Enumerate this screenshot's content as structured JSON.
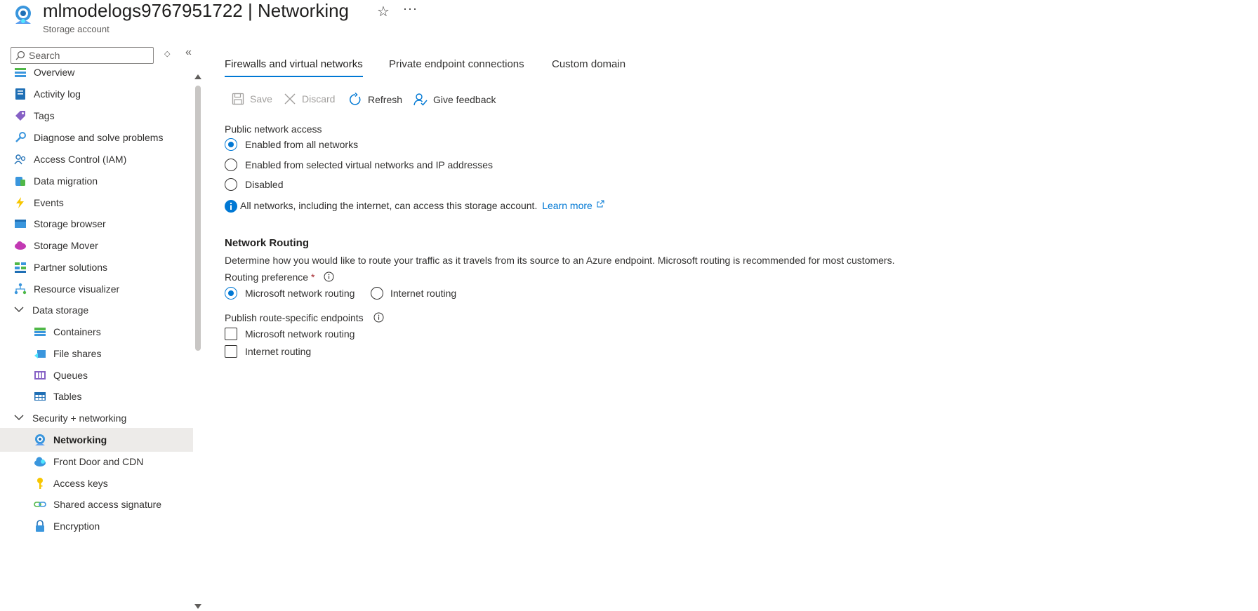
{
  "header": {
    "title": "mlmodelogs9767951722 | Networking",
    "subtitle": "Storage account",
    "more_label": "···"
  },
  "sidebar": {
    "search_placeholder": "Search",
    "items": [
      {
        "label": "Overview",
        "icon": "overview-icon"
      },
      {
        "label": "Activity log",
        "icon": "activity-log-icon"
      },
      {
        "label": "Tags",
        "icon": "tag-icon"
      },
      {
        "label": "Diagnose and solve problems",
        "icon": "wrench-icon"
      },
      {
        "label": "Access Control (IAM)",
        "icon": "people-icon"
      },
      {
        "label": "Data migration",
        "icon": "migration-icon"
      },
      {
        "label": "Events",
        "icon": "lightning-icon"
      },
      {
        "label": "Storage browser",
        "icon": "folder-icon"
      },
      {
        "label": "Storage Mover",
        "icon": "cloud-mover-icon"
      },
      {
        "label": "Partner solutions",
        "icon": "partner-icon"
      },
      {
        "label": "Resource visualizer",
        "icon": "hierarchy-icon"
      },
      {
        "label": "Data storage",
        "icon": "chevron-down-icon"
      },
      {
        "label": "Containers",
        "icon": "container-icon"
      },
      {
        "label": "File shares",
        "icon": "file-share-icon"
      },
      {
        "label": "Queues",
        "icon": "queue-icon"
      },
      {
        "label": "Tables",
        "icon": "table-icon"
      },
      {
        "label": "Security + networking",
        "icon": "chevron-down-icon"
      },
      {
        "label": "Networking",
        "icon": "networking-icon"
      },
      {
        "label": "Front Door and CDN",
        "icon": "cloud-icon"
      },
      {
        "label": "Access keys",
        "icon": "key-icon"
      },
      {
        "label": "Shared access signature",
        "icon": "link-icon"
      },
      {
        "label": "Encryption",
        "icon": "lock-icon"
      }
    ]
  },
  "tabs": [
    {
      "label": "Firewalls and virtual networks",
      "active": true
    },
    {
      "label": "Private endpoint connections",
      "active": false
    },
    {
      "label": "Custom domain",
      "active": false
    }
  ],
  "toolbar": {
    "save": "Save",
    "discard": "Discard",
    "refresh": "Refresh",
    "feedback": "Give feedback"
  },
  "public_access": {
    "label": "Public network access",
    "options": [
      {
        "label": "Enabled from all networks",
        "checked": true
      },
      {
        "label": "Enabled from selected virtual networks and IP addresses",
        "checked": false
      },
      {
        "label": "Disabled",
        "checked": false
      }
    ],
    "info_text": "All networks, including the internet, can access this storage account.",
    "learn_more": "Learn more"
  },
  "routing": {
    "title": "Network Routing",
    "description": "Determine how you would like to route your traffic as it travels from its source to an Azure endpoint. Microsoft routing is recommended for most customers.",
    "preference_label": "Routing preference",
    "required_mark": "*",
    "preference_options": [
      {
        "label": "Microsoft network routing",
        "checked": true
      },
      {
        "label": "Internet routing",
        "checked": false
      }
    ],
    "publish_label": "Publish route-specific endpoints",
    "publish_options": [
      {
        "label": "Microsoft network routing",
        "checked": false
      },
      {
        "label": "Internet routing",
        "checked": false
      }
    ]
  },
  "colors": {
    "accent": "#0078d4",
    "nav_active_bg": "#edebe9",
    "required": "#a4262c"
  }
}
